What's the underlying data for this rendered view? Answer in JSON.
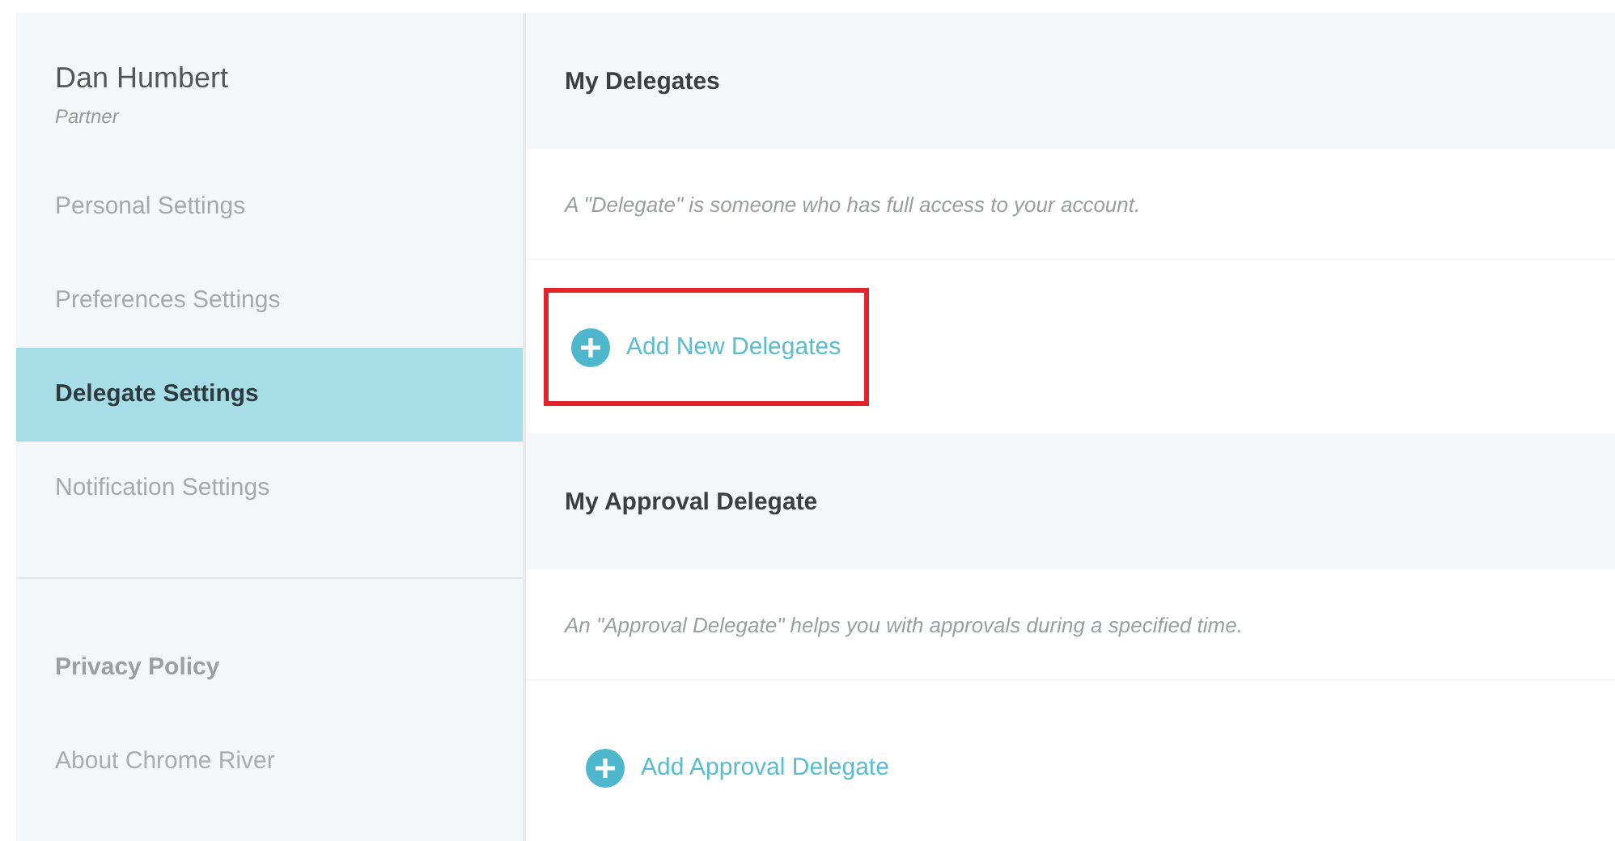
{
  "user": {
    "name": "Dan Humbert",
    "role": "Partner"
  },
  "nav": [
    {
      "label": "Personal Settings",
      "selected": false
    },
    {
      "label": "Preferences Settings",
      "selected": false
    },
    {
      "label": "Delegate Settings",
      "selected": true
    },
    {
      "label": "Notification Settings",
      "selected": false
    }
  ],
  "links": [
    {
      "label": "Privacy Policy",
      "kind": "strong"
    },
    {
      "label": "About Chrome River",
      "kind": "plain"
    }
  ],
  "sections": [
    {
      "title": "My Delegates",
      "description": "A \"Delegate\" is someone who has full access to your account.",
      "action": {
        "label": "Add New Delegates",
        "highlighted": true
      }
    },
    {
      "title": "My Approval Delegate",
      "description": "An \"Approval Delegate\" helps you with approvals during a specified time.",
      "action": {
        "label": "Add Approval Delegate",
        "highlighted": false
      }
    }
  ]
}
